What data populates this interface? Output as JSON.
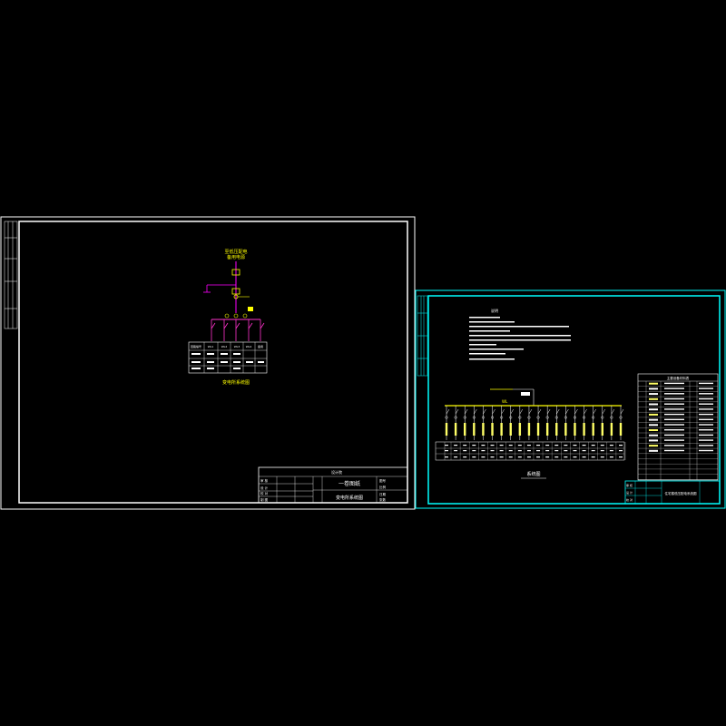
{
  "sheet1": {
    "feeder_label_top": "至低压配电",
    "feeder_label_sub": "备用电源",
    "caption": "变电所系统图",
    "title_block": {
      "project": "一卷图纸",
      "drawing_name": "变电所系统图",
      "company": "设计院",
      "rows": [
        "审 核",
        "设 计",
        "校 对",
        "制 图"
      ],
      "right_cells": [
        "图号",
        "比例",
        "日期",
        "张数"
      ]
    },
    "table_headers": [
      "回路编号",
      "WL1",
      "WL2",
      "WL3",
      "WL4",
      "备用"
    ],
    "colors": {
      "frame": "#ffffff",
      "vertical_bus": "#ff00ff",
      "component": "#ffff00",
      "branch": "#ff33cc"
    }
  },
  "sheet2": {
    "notes_title": "说明",
    "bus_label": "WL",
    "caption": "系统图",
    "legend_title": "主要设备材料表",
    "title_block": {
      "drawing_name": "住宅楼低压配电系统图",
      "rows": [
        "审 核",
        "设 计",
        "校 对"
      ]
    },
    "colors": {
      "frame": "#00ffff",
      "bus": "#ffff00",
      "text": "#ffffff"
    }
  }
}
